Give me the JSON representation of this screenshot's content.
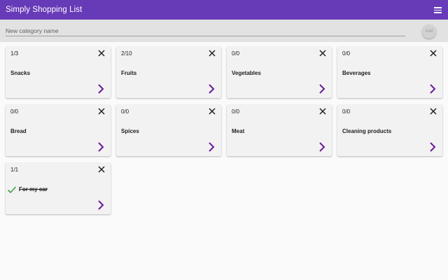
{
  "app": {
    "title": "Simply Shopping List",
    "menu_icon": "hamburger-menu-icon",
    "accent_color": "#673ab7"
  },
  "add_category": {
    "placeholder": "New category name",
    "value": "",
    "button_label": "Add"
  },
  "categories": [
    {
      "count": "1/3",
      "name": "Snacks",
      "completed": false
    },
    {
      "count": "2/10",
      "name": "Fruits",
      "completed": false
    },
    {
      "count": "0/0",
      "name": "Vegetables",
      "completed": false
    },
    {
      "count": "0/0",
      "name": "Beverages",
      "completed": false
    },
    {
      "count": "0/0",
      "name": "Bread",
      "completed": false
    },
    {
      "count": "0/0",
      "name": "Spices",
      "completed": false
    },
    {
      "count": "0/0",
      "name": "Meat",
      "completed": false
    },
    {
      "count": "0/0",
      "name": "Cleaning products",
      "completed": false
    },
    {
      "count": "1/1",
      "name": "For my car",
      "completed": true
    }
  ],
  "icons": {
    "delete": "close-icon",
    "open": "chevron-right-icon",
    "done": "check-icon"
  },
  "colors": {
    "chevron": "#6a1b9a",
    "check": "#43a047"
  }
}
